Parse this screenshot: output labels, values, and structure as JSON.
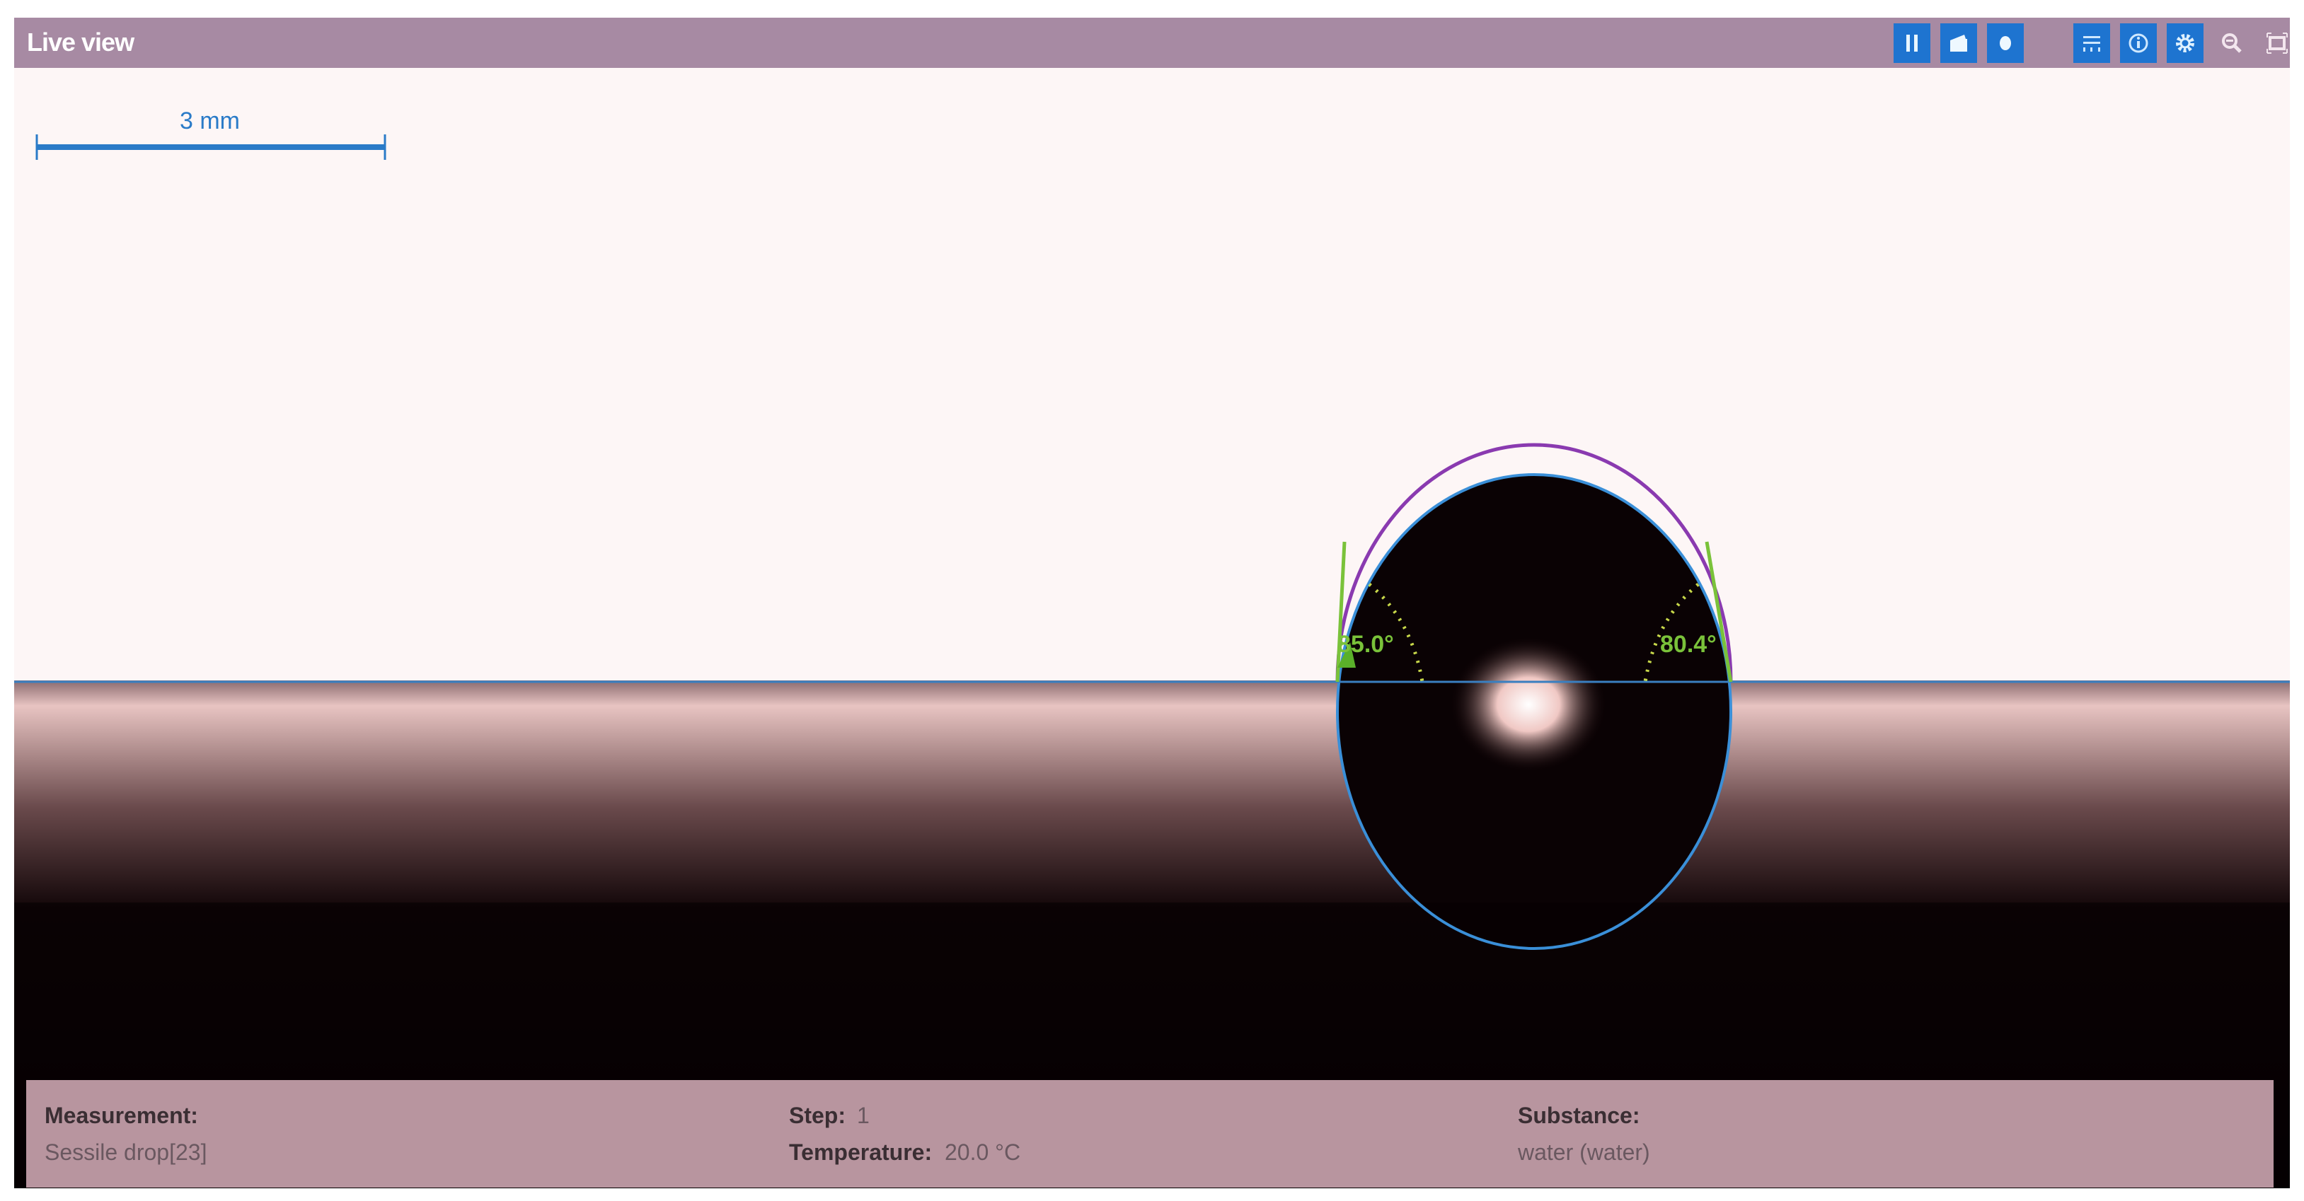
{
  "window": {
    "title": "Live view"
  },
  "toolbar": {
    "buttons": [
      {
        "name": "pause-button",
        "icon": "pause-icon"
      },
      {
        "name": "open-button",
        "icon": "folder-icon"
      },
      {
        "name": "record-button",
        "icon": "record-icon"
      },
      {
        "name": "baseline-button",
        "icon": "baseline-icon"
      },
      {
        "name": "info-button",
        "icon": "info-icon"
      },
      {
        "name": "settings-button",
        "icon": "gear-icon"
      },
      {
        "name": "zoom-button",
        "icon": "zoom-out-icon"
      },
      {
        "name": "fit-button",
        "icon": "fit-screen-icon"
      }
    ]
  },
  "image": {
    "scale_bar_label": "3 mm",
    "left_angle": "85.0°",
    "right_angle": "80.4°"
  },
  "info_panel": {
    "measurement_label": "Measurement:",
    "measurement_value": "Sessile drop[23]",
    "step_label": "Step:",
    "step_value": "1",
    "temperature_label": "Temperature:",
    "temperature_value": "20.0 °C",
    "substance_label": "Substance:",
    "substance_value": "water (water)"
  },
  "colors": {
    "titlebar": "#a78aa3",
    "toolbar_button": "#1e74d0",
    "panel": "#b8959f",
    "angle": "#7ac23a",
    "fit_circle": "#3a8fd8"
  }
}
